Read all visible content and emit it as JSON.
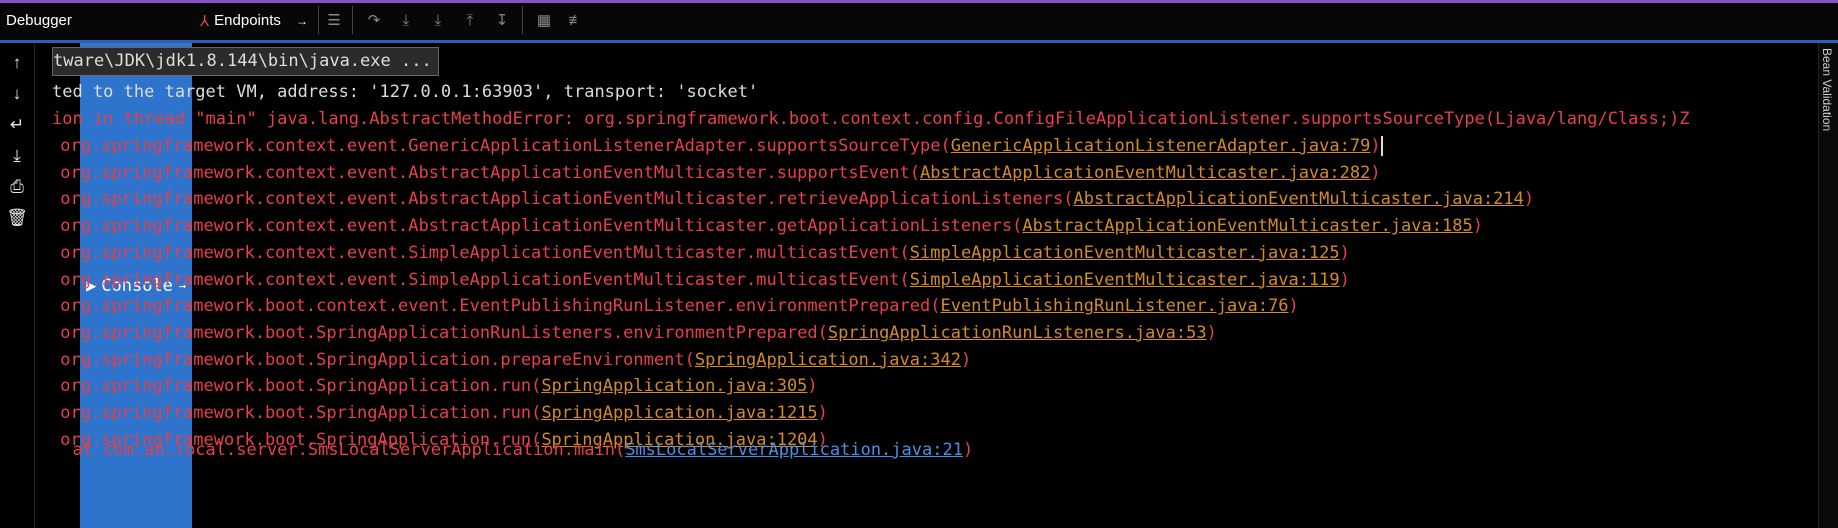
{
  "tabs": {
    "debugger": "Debugger",
    "console": "Console",
    "endpoints": "Endpoints"
  },
  "side_label": "Bean Validation",
  "console": {
    "command_line": "tware\\JDK\\jdk1.8.144\\bin\\java.exe ...",
    "connected_line": "ted to the target VM, address: '127.0.0.1:63903', transport: 'socket'",
    "exception_line": "ion in thread \"main\" java.lang.AbstractMethodError: org.springframework.boot.context.config.ConfigFileApplicationListener.supportsSourceType(Ljava/lang/Class;)Z",
    "stack": [
      {
        "method": "org.springframework.context.event.GenericApplicationListenerAdapter.supportsSourceType",
        "source": "GenericApplicationListenerAdapter.java:79"
      },
      {
        "method": "org.springframework.context.event.AbstractApplicationEventMulticaster.supportsEvent",
        "source": "AbstractApplicationEventMulticaster.java:282"
      },
      {
        "method": "org.springframework.context.event.AbstractApplicationEventMulticaster.retrieveApplicationListeners",
        "source": "AbstractApplicationEventMulticaster.java:214"
      },
      {
        "method": "org.springframework.context.event.AbstractApplicationEventMulticaster.getApplicationListeners",
        "source": "AbstractApplicationEventMulticaster.java:185"
      },
      {
        "method": "org.springframework.context.event.SimpleApplicationEventMulticaster.multicastEvent",
        "source": "SimpleApplicationEventMulticaster.java:125"
      },
      {
        "method": "org.springframework.context.event.SimpleApplicationEventMulticaster.multicastEvent",
        "source": "SimpleApplicationEventMulticaster.java:119"
      },
      {
        "method": "org.springframework.boot.context.event.EventPublishingRunListener.environmentPrepared",
        "source": "EventPublishingRunListener.java:76"
      },
      {
        "method": "org.springframework.boot.SpringApplicationRunListeners.environmentPrepared",
        "source": "SpringApplicationRunListeners.java:53"
      },
      {
        "method": "org.springframework.boot.SpringApplication.prepareEnvironment",
        "source": "SpringApplication.java:342"
      },
      {
        "method": "org.springframework.boot.SpringApplication.run",
        "source": "SpringApplication.java:305"
      },
      {
        "method": "org.springframework.boot.SpringApplication.run",
        "source": "SpringApplication.java:1215"
      },
      {
        "method": "org.springframework.boot.SpringApplication.run",
        "source": "SpringApplication.java:1204"
      }
    ],
    "partial_last_line": {
      "method": "com.an.local.server.SmsLocalServerApplication.main",
      "source": "SmsLocalServerApplication.java:21"
    }
  },
  "colors": {
    "error": "#e6404a",
    "link": "#d58a28",
    "user_link": "#4d8ee8",
    "tab_active": "#2e74cc"
  }
}
